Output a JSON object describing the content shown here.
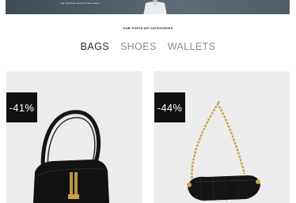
{
  "hero": {
    "text": "The must-have pieces for the season"
  },
  "categories": {
    "title": "OUR POPULAR CATEGORIES",
    "tabs": [
      {
        "label": "BAGS",
        "active": true
      },
      {
        "label": "SHOES",
        "active": false
      },
      {
        "label": "WALLETS",
        "active": false
      }
    ]
  },
  "products": [
    {
      "discount": "-41%",
      "image_icon": "black-shoulder-bag-image"
    },
    {
      "discount": "-44%",
      "image_icon": "black-chain-bag-image"
    }
  ],
  "colors": {
    "badge_bg": "#111111",
    "card_bg": "#ececec",
    "active_tab": "#2b2b2b",
    "inactive_tab": "#8c8c8c"
  }
}
